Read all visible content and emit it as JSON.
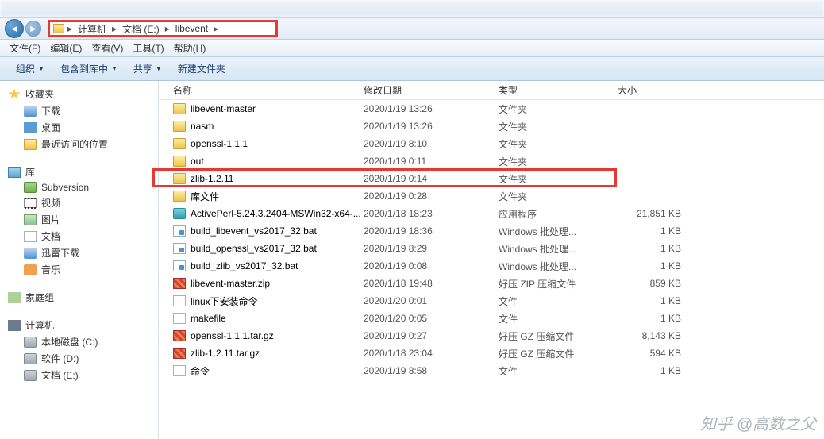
{
  "breadcrumb": {
    "root": "计算机",
    "drive": "文档 (E:)",
    "folder": "libevent"
  },
  "menu": {
    "file": "文件(F)",
    "edit": "编辑(E)",
    "view": "查看(V)",
    "tools": "工具(T)",
    "help": "帮助(H)"
  },
  "toolbar": {
    "organize": "组织",
    "include": "包含到库中",
    "share": "共享",
    "newfolder": "新建文件夹"
  },
  "columns": {
    "name": "名称",
    "date": "修改日期",
    "type": "类型",
    "size": "大小"
  },
  "sidebar": {
    "fav": "收藏夹",
    "downloads": "下载",
    "desktop": "桌面",
    "recent": "最近访问的位置",
    "lib": "库",
    "svn": "Subversion",
    "video": "视频",
    "pics": "图片",
    "docs": "文档",
    "xunlei": "迅雷下载",
    "music": "音乐",
    "homegroup": "家庭组",
    "pc": "计算机",
    "cdisk": "本地磁盘 (C:)",
    "ddisk": "软件 (D:)",
    "edisk": "文档 (E:)"
  },
  "files": [
    {
      "name": "libevent-master",
      "date": "2020/1/19 13:26",
      "type": "文件夹",
      "size": "",
      "icon": "folder"
    },
    {
      "name": "nasm",
      "date": "2020/1/19 13:26",
      "type": "文件夹",
      "size": "",
      "icon": "folder"
    },
    {
      "name": "openssl-1.1.1",
      "date": "2020/1/19 8:10",
      "type": "文件夹",
      "size": "",
      "icon": "folder"
    },
    {
      "name": "out",
      "date": "2020/1/19 0:11",
      "type": "文件夹",
      "size": "",
      "icon": "folder"
    },
    {
      "name": "zlib-1.2.11",
      "date": "2020/1/19 0:14",
      "type": "文件夹",
      "size": "",
      "icon": "folder",
      "highlight": true
    },
    {
      "name": "库文件",
      "date": "2020/1/19 0:28",
      "type": "文件夹",
      "size": "",
      "icon": "folder"
    },
    {
      "name": "ActivePerl-5.24.3.2404-MSWin32-x64-...",
      "date": "2020/1/18 18:23",
      "type": "应用程序",
      "size": "21,851 KB",
      "icon": "exe"
    },
    {
      "name": "build_libevent_vs2017_32.bat",
      "date": "2020/1/19 18:36",
      "type": "Windows 批处理...",
      "size": "1 KB",
      "icon": "bat"
    },
    {
      "name": "build_openssl_vs2017_32.bat",
      "date": "2020/1/19 8:29",
      "type": "Windows 批处理...",
      "size": "1 KB",
      "icon": "bat"
    },
    {
      "name": "build_zlib_vs2017_32.bat",
      "date": "2020/1/19 0:08",
      "type": "Windows 批处理...",
      "size": "1 KB",
      "icon": "bat"
    },
    {
      "name": "libevent-master.zip",
      "date": "2020/1/18 19:48",
      "type": "好压 ZIP 压缩文件",
      "size": "859 KB",
      "icon": "zip"
    },
    {
      "name": "linux下安装命令",
      "date": "2020/1/20 0:01",
      "type": "文件",
      "size": "1 KB",
      "icon": "file"
    },
    {
      "name": "makefile",
      "date": "2020/1/20 0:05",
      "type": "文件",
      "size": "1 KB",
      "icon": "file"
    },
    {
      "name": "openssl-1.1.1.tar.gz",
      "date": "2020/1/19 0:27",
      "type": "好压 GZ 压缩文件",
      "size": "8,143 KB",
      "icon": "zip"
    },
    {
      "name": "zlib-1.2.11.tar.gz",
      "date": "2020/1/18 23:04",
      "type": "好压 GZ 压缩文件",
      "size": "594 KB",
      "icon": "zip"
    },
    {
      "name": "命令",
      "date": "2020/1/19 8:58",
      "type": "文件",
      "size": "1 KB",
      "icon": "file"
    }
  ],
  "watermark": "知乎 @高数之父"
}
